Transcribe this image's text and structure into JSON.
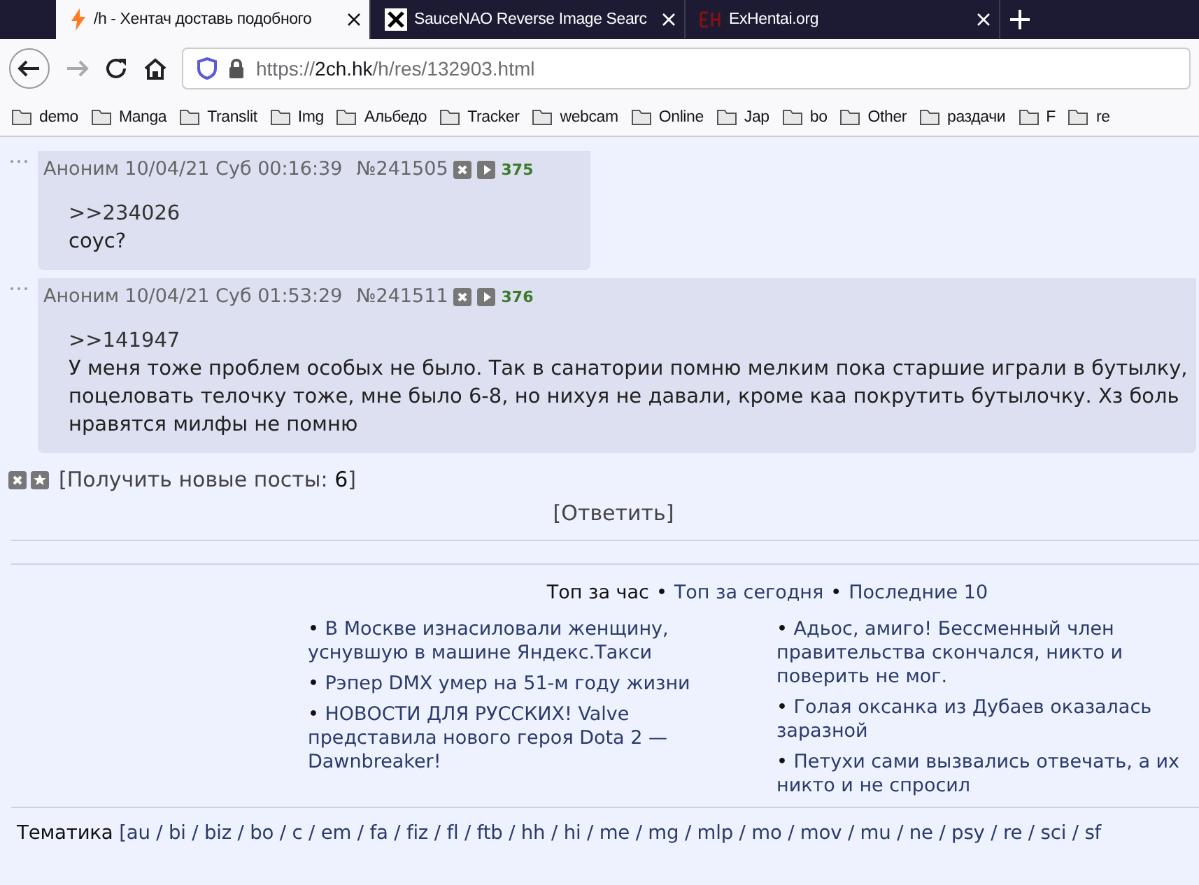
{
  "browser": {
    "tabs": [
      {
        "title": "/h - Хентач доставь подобного",
        "selected": true
      },
      {
        "title": "SauceNAO Reverse Image Searc",
        "selected": false
      },
      {
        "title": "ExHentai.org",
        "selected": false
      }
    ],
    "url": {
      "prefix": "https://",
      "host": "2ch.hk",
      "path": "/h/res/132903.html"
    },
    "bookmarks": [
      "demo",
      "Manga",
      "Translit",
      "Img",
      "Альбедо",
      "Tracker",
      "webcam",
      "Online",
      "Jap",
      "bo",
      "Other",
      "раздачи",
      "F",
      "re"
    ]
  },
  "posts": [
    {
      "name": "Аноним",
      "date": "10/04/21 Суб 00:16:39",
      "number": "№241505",
      "count": "375",
      "reply": ">>234026",
      "body": [
        "соус?"
      ]
    },
    {
      "name": "Аноним",
      "date": "10/04/21 Суб 01:53:29",
      "number": "№241511",
      "count": "376",
      "reply": ">>141947",
      "body": [
        "У меня тоже проблем особых не было. Так в санатории помню мелким пока старшие играли в бутылку,",
        "поцеловать телочку тоже, мне было 6-8, но нихуя не давали, кроме каа покрутить бутылочку. Хз боль",
        "нравятся милфы не помню"
      ]
    }
  ],
  "new_posts": {
    "open": "[",
    "label": "Получить новые посты:",
    "count": "6",
    "close": "]"
  },
  "reply_link": "[Ответить]",
  "top": {
    "separator": "•",
    "tabs": [
      {
        "label": "Топ за час",
        "selected": true
      },
      {
        "label": "Топ за сегодня",
        "selected": false
      },
      {
        "label": "Последние 10",
        "selected": false
      }
    ],
    "bullet": "•",
    "columns": [
      [
        "В Москве изнасиловали женщину, уснувшую в машине Яндекс.Такси",
        "Рэпер DMX умер на 51-м году жизни",
        "НОВОСТИ ДЛЯ РУССКИХ! Valve представила нового героя Dota 2 — Dawnbreaker!"
      ],
      [
        "Адьос, амиго! Бессменный член правительства скончался, никто и поверить не мог.",
        "Голая оксанка из Дубаев оказалась заразной",
        "Петухи сами вызвались отвечать, а их никто и не спросил"
      ]
    ]
  },
  "boards": {
    "label": "Тематика",
    "links": "[au / bi / biz / bo / c / em / fa / fiz / fl / ftb / hh / hi / me / mg / mlp / mo / mov / mu / ne / psy / re / sci / sf"
  }
}
